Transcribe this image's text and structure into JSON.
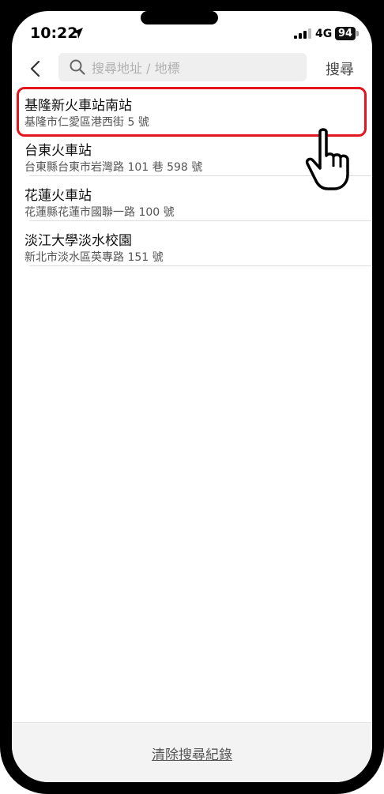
{
  "status_bar": {
    "time": "10:22",
    "network": "4G",
    "battery": "94"
  },
  "search": {
    "placeholder": "搜尋地址 / 地標",
    "button_label": "搜尋"
  },
  "results": [
    {
      "title": "基隆新火車站南站",
      "address": "基隆市仁愛區港西街 5 號"
    },
    {
      "title": "台東火車站",
      "address": "台東縣台東市岩灣路 101 巷 598 號"
    },
    {
      "title": "花蓮火車站",
      "address": "花蓮縣花蓮市國聯一路 100 號"
    },
    {
      "title": "淡江大學淡水校園",
      "address": "新北市淡水區英專路 151 號"
    }
  ],
  "footer": {
    "clear_label": "清除搜尋紀錄"
  },
  "colors": {
    "highlight": "#e3151f"
  }
}
